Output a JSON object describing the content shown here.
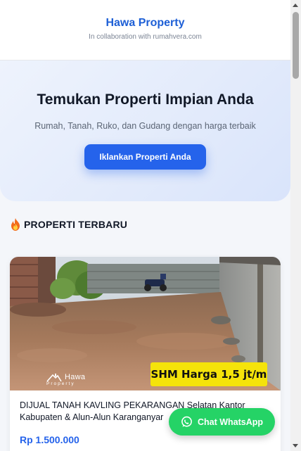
{
  "header": {
    "title": "Hawa Property",
    "subtitle": "In collaboration with rumahvera.com"
  },
  "hero": {
    "heading": "Temukan Properti Impian Anda",
    "tagline": "Rumah, Tanah, Ruko, dan Gudang dengan harga terbaik",
    "cta_label": "Iklankan Properti Anda"
  },
  "section": {
    "icon": "fire-icon",
    "title": "PROPERTI TERBARU"
  },
  "listing": {
    "photo_badge": "SHM Harga 1,5 jt/m",
    "watermark_name": "Hawa",
    "watermark_sub": "Property",
    "title": "DIJUAL TANAH KAVLING PEKARANGAN Selatan Kantor Kabupaten & Alun-Alun Karanganyar",
    "price": "Rp 1.500.000"
  },
  "whatsapp": {
    "label": "Chat WhatsApp",
    "icon": "whatsapp-icon"
  },
  "colors": {
    "brand": "#1d5fd6",
    "primary_button": "#2563eb",
    "whatsapp": "#25d366",
    "badge": "#f5e30a"
  }
}
